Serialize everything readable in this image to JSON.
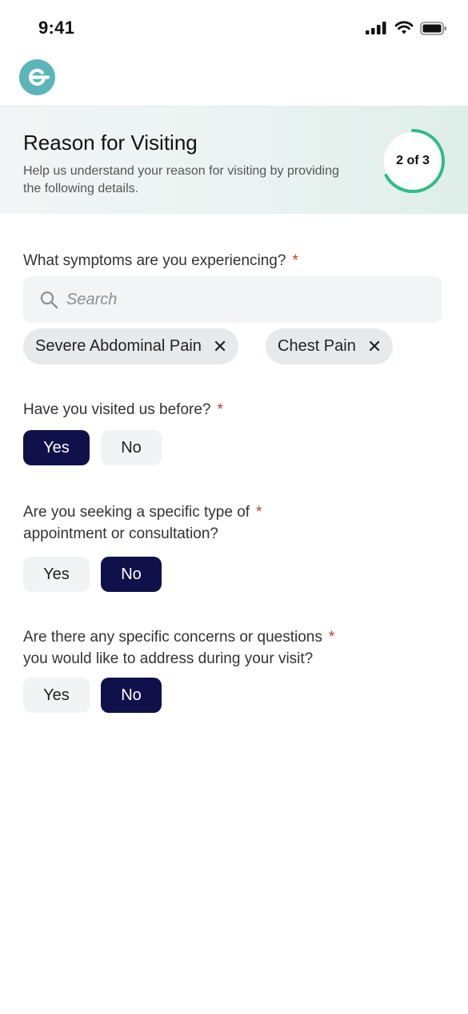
{
  "status_bar": {
    "time": "9:41"
  },
  "step": {
    "title": "Reason for Visiting",
    "description": "Help us understand your reason for visiting by providing the following details.",
    "progress_label": "2 of 3",
    "progress_fraction": 0.67
  },
  "questions": [
    {
      "text": "What symptoms are you experiencing?",
      "required_mark": "*",
      "search_placeholder": "Search",
      "chips": [
        "Severe Abdominal Pain",
        "Chest Pain"
      ],
      "remove_glyph": "✕"
    },
    {
      "text": "Have you visited us before?",
      "required_mark": "*",
      "options": [
        "Yes",
        "No"
      ],
      "selected": "Yes"
    },
    {
      "text_line1": "Are you seeking a specific type of",
      "text_line2": "appointment or consultation?",
      "required_mark": "*",
      "options": [
        "Yes",
        "No"
      ],
      "selected": "No"
    },
    {
      "text_line1": "Are there any specific concerns or questions",
      "text_line2": "you would like to address during your visit?",
      "required_mark": "*",
      "options": [
        "Yes",
        "No"
      ],
      "selected": "No"
    }
  ],
  "colors": {
    "brand_teal": "#5bb5b9",
    "selected_navy": "#10104a",
    "progress_green": "#2dbe86",
    "required_red": "#c0392b"
  },
  "icons": [
    "cellular-signal-icon",
    "wifi-icon",
    "battery-icon",
    "app-logo",
    "search-icon",
    "close-icon"
  ]
}
